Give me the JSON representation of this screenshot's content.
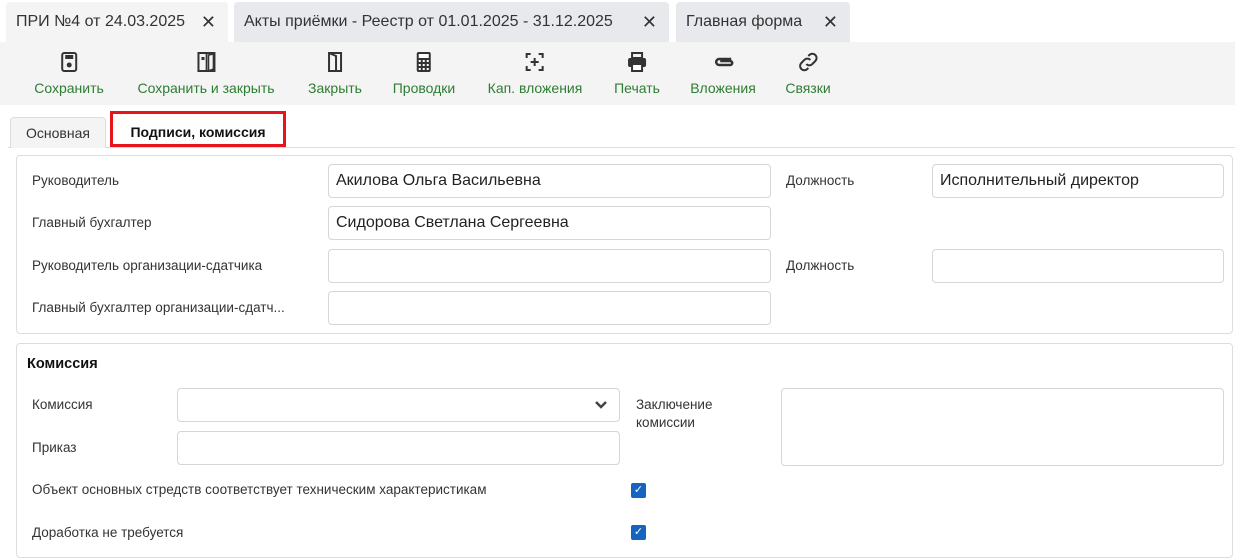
{
  "doc_tabs": [
    {
      "label": "ПРИ №4 от 24.03.2025",
      "active": true
    },
    {
      "label": "Акты приёмки - Реестр от 01.01.2025 - 31.12.2025",
      "active": false
    },
    {
      "label": "Главная форма",
      "active": false
    }
  ],
  "toolbar": {
    "save": "Сохранить",
    "save_close": "Сохранить и закрыть",
    "close": "Закрыть",
    "postings": "Проводки",
    "cap_invest": "Кап. вложения",
    "print": "Печать",
    "attachments": "Вложения",
    "links": "Связки"
  },
  "form_tabs": {
    "main": "Основная",
    "signatures": "Подписи, комиссия",
    "active": "signatures",
    "highlight_color": "#e8141c"
  },
  "signatures": {
    "head_label": "Руководитель",
    "head_value": "Акилова Ольга Васильевна",
    "position_label": "Должность",
    "head_position_value": "Исполнительный директор",
    "chief_acc_label": "Главный бухгалтер",
    "chief_acc_value": "Сидорова Светлана Сергеевна",
    "sender_head_label": "Руководитель организации-сдатчика",
    "sender_head_value": "",
    "sender_position_label": "Должность",
    "sender_position_value": "",
    "sender_acc_label": "Главный бухгалтер организации-сдатч...",
    "sender_acc_value": ""
  },
  "commission": {
    "title": "Комиссия",
    "commission_label": "Комиссия",
    "commission_value": "",
    "order_label": "Приказ",
    "order_value": "",
    "conclusion_label_1": "Заключение",
    "conclusion_label_2": "комиссии",
    "conclusion_value": "",
    "check1_label": "Объект основных стредств соответствует техническим характеристикам",
    "check1": true,
    "check2_label": "Доработка не требуется",
    "check2": true
  },
  "accent_color": "#2e7d32"
}
